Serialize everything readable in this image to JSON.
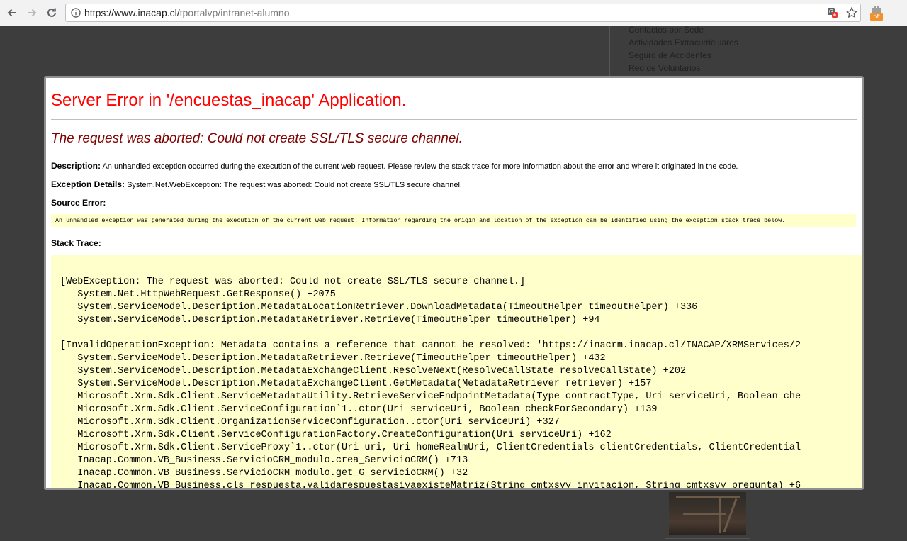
{
  "browser": {
    "url_host": "https://www.inacap.cl/",
    "url_path": "tportalvp/intranet-alumno",
    "extension_badge": "off"
  },
  "background": {
    "sidebar_links": [
      "Contactos por Sede",
      "Actividades Extracurriculares",
      "Seguro de Accidentes",
      "Red de Voluntarios"
    ]
  },
  "error": {
    "title": "Server Error in '/encuestas_inacap' Application.",
    "subtitle": "The request was aborted: Could not create SSL/TLS secure channel.",
    "description_label": "Description:",
    "description_text": "An unhandled exception occurred during the execution of the current web request. Please review the stack trace for more information about the error and where it originated in the code.",
    "exception_label": "Exception Details:",
    "exception_text": "System.Net.WebException: The request was aborted: Could not create SSL/TLS secure channel.",
    "source_label": "Source Error:",
    "source_text": "An unhandled exception was generated during the execution of the current web request. Information regarding the origin and location of the exception can be identified using the exception stack trace below.",
    "stack_label": "Stack Trace:",
    "stack_lines": [
      "[WebException: The request was aborted: Could not create SSL/TLS secure channel.]",
      "   System.Net.HttpWebRequest.GetResponse() +2075",
      "   System.ServiceModel.Description.MetadataLocationRetriever.DownloadMetadata(TimeoutHelper timeoutHelper) +336",
      "   System.ServiceModel.Description.MetadataRetriever.Retrieve(TimeoutHelper timeoutHelper) +94",
      "",
      "[InvalidOperationException: Metadata contains a reference that cannot be resolved: 'https://inacrm.inacap.cl/INACAP/XRMServices/2",
      "   System.ServiceModel.Description.MetadataRetriever.Retrieve(TimeoutHelper timeoutHelper) +432",
      "   System.ServiceModel.Description.MetadataExchangeClient.ResolveNext(ResolveCallState resolveCallState) +202",
      "   System.ServiceModel.Description.MetadataExchangeClient.GetMetadata(MetadataRetriever retriever) +157",
      "   Microsoft.Xrm.Sdk.Client.ServiceMetadataUtility.RetrieveServiceEndpointMetadata(Type contractType, Uri serviceUri, Boolean che",
      "   Microsoft.Xrm.Sdk.Client.ServiceConfiguration`1..ctor(Uri serviceUri, Boolean checkForSecondary) +139",
      "   Microsoft.Xrm.Sdk.Client.OrganizationServiceConfiguration..ctor(Uri serviceUri) +327",
      "   Microsoft.Xrm.Sdk.Client.ServiceConfigurationFactory.CreateConfiguration(Uri serviceUri) +162",
      "   Microsoft.Xrm.Sdk.Client.ServiceProxy`1..ctor(Uri uri, Uri homeRealmUri, ClientCredentials clientCredentials, ClientCredential",
      "   Inacap.Common.VB_Business.ServicioCRM_modulo.crea_ServicioCRM() +713",
      "   Inacap.Common.VB_Business.ServicioCRM_modulo.get_G_servicioCRM() +32",
      "   Inacap.Common.VB_Business.cls_respuesta.validarespuestasiyaexisteMatriz(String cmtxsvy_invitacion, String cmtxsvy_pregunta) +6"
    ]
  }
}
